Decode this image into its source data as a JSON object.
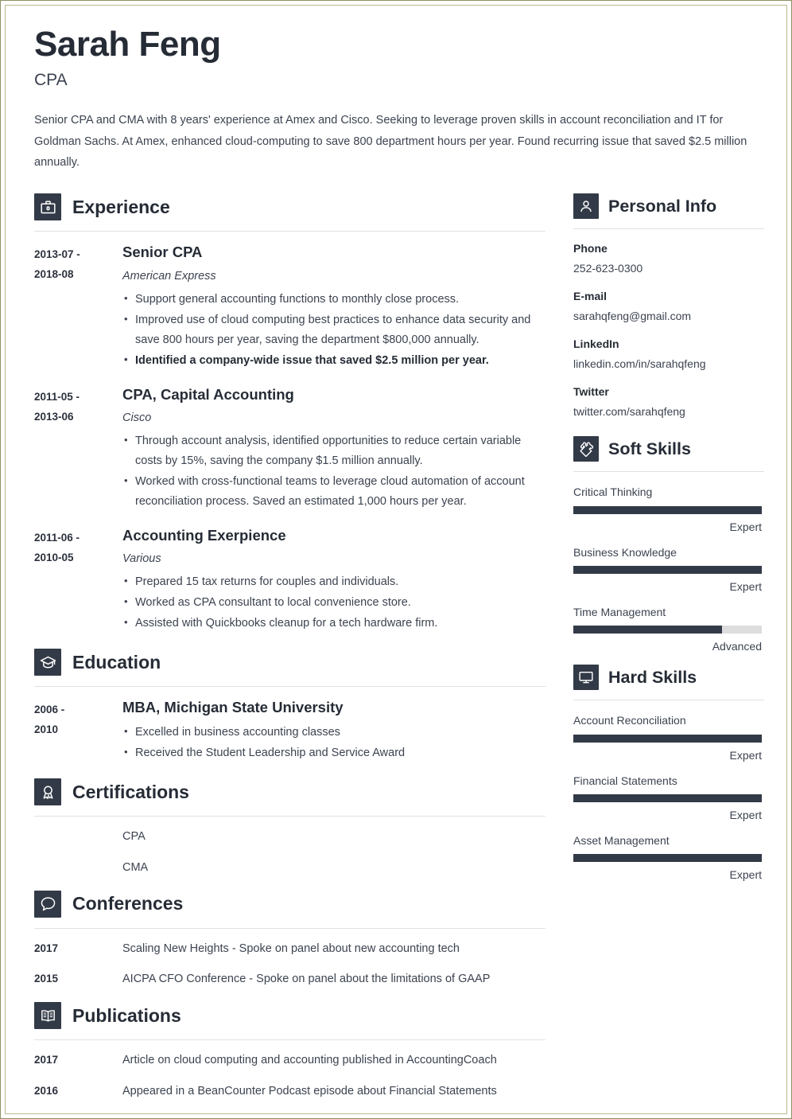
{
  "header": {
    "name": "Sarah Feng",
    "job_title": "CPA",
    "summary": "Senior CPA and CMA with 8 years' experience at Amex and Cisco. Seeking to leverage proven skills in account reconciliation and IT for Goldman Sachs. At Amex, enhanced cloud-computing to save 800 department hours per year. Found recurring issue that saved $2.5 million annually."
  },
  "theme": {
    "accent": "#333a47",
    "text": "#3c4350",
    "heading": "#262c36",
    "rule": "#dfe1e4",
    "track": "#dddddd",
    "page_border": "#8f8f62"
  },
  "experience": {
    "title": "Experience",
    "icon": "briefcase-icon",
    "entries": [
      {
        "date_start": "2013-07 -",
        "date_end": "2018-08",
        "title": "Senior CPA",
        "org": "American Express",
        "bullets": [
          {
            "text": "Support general accounting functions to monthly close process.",
            "bold": false
          },
          {
            "text": "Improved use of cloud computing best practices to enhance data security and save 800 hours per year, saving the department $800,000 annually.",
            "bold": false
          },
          {
            "text": "Identified a company-wide issue that saved $2.5 million per year.",
            "bold": true
          }
        ]
      },
      {
        "date_start": "2011-05 -",
        "date_end": "2013-06",
        "title": "CPA, Capital Accounting",
        "org": "Cisco",
        "bullets": [
          {
            "text": "Through account analysis, identified opportunities to reduce certain variable costs by 15%, saving the company $1.5 million annually.",
            "bold": false
          },
          {
            "text": "Worked with cross-functional teams to leverage cloud automation of account reconciliation process. Saved an estimated 1,000 hours per year.",
            "bold": false
          }
        ]
      },
      {
        "date_start": "2011-06 -",
        "date_end": "2010-05",
        "title": "Accounting Exerpience",
        "org": "Various",
        "bullets": [
          {
            "text": "Prepared 15 tax returns for couples and individuals.",
            "bold": false
          },
          {
            "text": "Worked as CPA consultant to local convenience store.",
            "bold": false
          },
          {
            "text": "Assisted with Quickbooks cleanup for a tech hardware firm.",
            "bold": false
          }
        ]
      }
    ]
  },
  "education": {
    "title": "Education",
    "icon": "graduation-cap-icon",
    "entries": [
      {
        "date_start": "2006 -",
        "date_end": "2010",
        "title": "MBA, Michigan State University",
        "bullets": [
          {
            "text": "Excelled in business accounting classes",
            "bold": false
          },
          {
            "text": "Received the Student Leadership and Service Award",
            "bold": false
          }
        ]
      }
    ]
  },
  "certifications": {
    "title": "Certifications",
    "icon": "award-ribbon-icon",
    "items": [
      {
        "date": "",
        "text": "CPA"
      },
      {
        "date": "",
        "text": "CMA"
      }
    ]
  },
  "conferences": {
    "title": "Conferences",
    "icon": "speech-bubble-icon",
    "items": [
      {
        "date": "2017",
        "text": "Scaling New Heights - Spoke on panel about new accounting tech"
      },
      {
        "date": "2015",
        "text": "AICPA CFO Conference - Spoke on panel about the limitations of GAAP"
      }
    ]
  },
  "publications": {
    "title": "Publications",
    "icon": "open-book-icon",
    "items": [
      {
        "date": "2017",
        "text": "Article on cloud computing and accounting published in AccountingCoach"
      },
      {
        "date": "2016",
        "text": "Appeared in a BeanCounter Podcast episode about Financial Statements"
      }
    ]
  },
  "personal_info": {
    "title": "Personal Info",
    "icon": "person-icon",
    "fields": [
      {
        "label": "Phone",
        "value": "252-623-0300"
      },
      {
        "label": "E-mail",
        "value": "sarahqfeng@gmail.com"
      },
      {
        "label": "LinkedIn",
        "value": "linkedin.com/in/sarahqfeng"
      },
      {
        "label": "Twitter",
        "value": "twitter.com/sarahqfeng"
      }
    ]
  },
  "soft_skills": {
    "title": "Soft Skills",
    "icon": "puzzle-piece-icon",
    "items": [
      {
        "name": "Critical Thinking",
        "level": "Expert",
        "percent": 100
      },
      {
        "name": "Business Knowledge",
        "level": "Expert",
        "percent": 100
      },
      {
        "name": "Time Management",
        "level": "Advanced",
        "percent": 79
      }
    ]
  },
  "hard_skills": {
    "title": "Hard Skills",
    "icon": "monitor-icon",
    "items": [
      {
        "name": "Account Reconciliation",
        "level": "Expert",
        "percent": 100
      },
      {
        "name": "Financial Statements",
        "level": "Expert",
        "percent": 100
      },
      {
        "name": "Asset Management",
        "level": "Expert",
        "percent": 100
      }
    ]
  }
}
